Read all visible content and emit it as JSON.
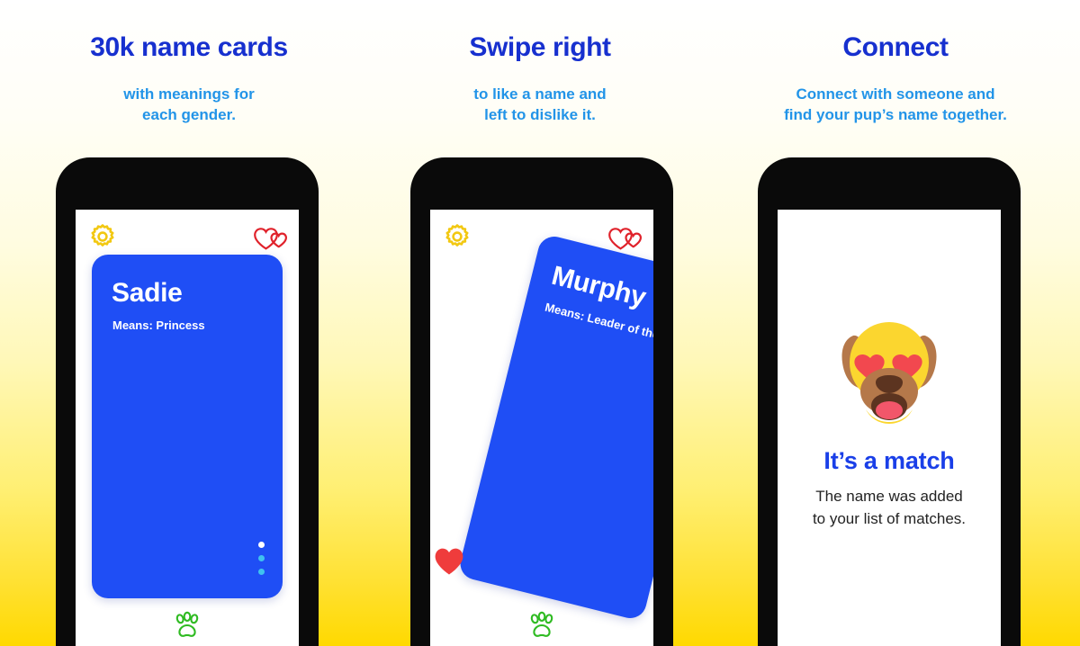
{
  "background": {
    "gradient_top": "#ffffff",
    "gradient_bottom": "#ffd900"
  },
  "colors": {
    "headline_blue": "#1730cf",
    "subhead_blue": "#2294e8",
    "card_blue": "#1f4ef5",
    "gear_yellow": "#f2c811",
    "heart_red": "#e0222b",
    "paw_green": "#2fbb22",
    "match_blue": "#1a3fe8",
    "dot_cyan": "#3fc2ef"
  },
  "panels": [
    {
      "headline": "30k name cards",
      "subhead_line1": "with meanings for",
      "subhead_line2": "each gender.",
      "icons": {
        "settings": "gear-icon",
        "matches": "double-heart-icon",
        "nav": "paw-icon"
      },
      "card": {
        "name": "Sadie",
        "meaning": "Means: Princess",
        "dots_total": 3,
        "dot_active_index": 0
      }
    },
    {
      "headline": "Swipe right",
      "subhead_line1": "to like a name and",
      "subhead_line2": "left to dislike it.",
      "icons": {
        "settings": "gear-icon",
        "matches": "double-heart-icon",
        "nav": "paw-icon",
        "like": "heart-icon"
      },
      "card": {
        "name": "Murphy",
        "meaning": "Means: Leader of the herd",
        "rotation_deg": 14
      }
    },
    {
      "headline": "Connect",
      "subhead_line1": "Connect with someone and",
      "subhead_line2": "find your pup’s name together.",
      "match": {
        "emoji": "dog-face-heart-eyes-emoji",
        "title": "It’s a match",
        "body_line1": "The name was added",
        "body_line2": "to your list of matches."
      }
    }
  ]
}
